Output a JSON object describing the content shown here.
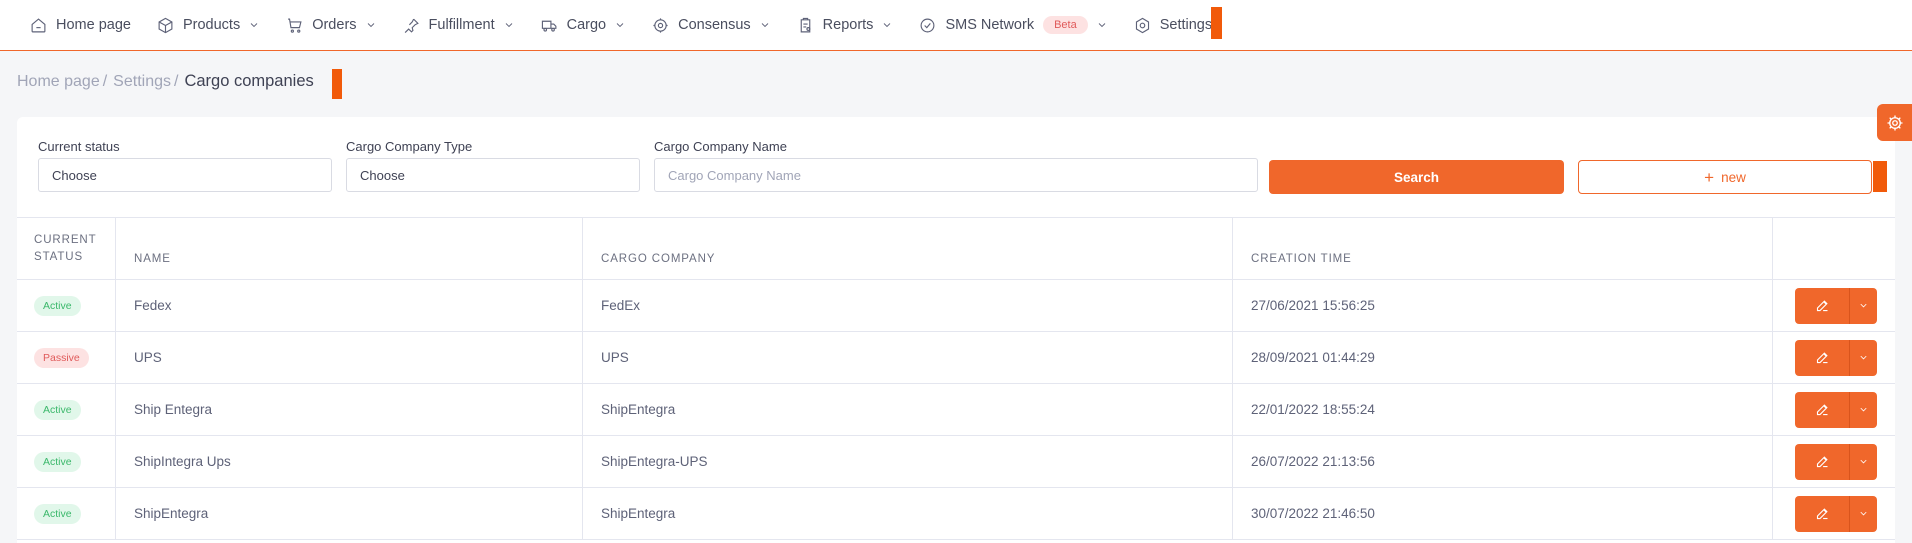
{
  "nav": {
    "items": [
      {
        "label": "Home page",
        "icon": "home-icon",
        "dropdown": false
      },
      {
        "label": "Products",
        "icon": "cube-icon",
        "dropdown": true
      },
      {
        "label": "Orders",
        "icon": "cart-icon",
        "dropdown": true
      },
      {
        "label": "Fulfillment",
        "icon": "pin-icon",
        "dropdown": true
      },
      {
        "label": "Cargo",
        "icon": "truck-icon",
        "dropdown": true
      },
      {
        "label": "Consensus",
        "icon": "target-icon",
        "dropdown": true
      },
      {
        "label": "Reports",
        "icon": "report-icon",
        "dropdown": true
      },
      {
        "label": "SMS Network",
        "icon": "check-circle-icon",
        "dropdown": true,
        "badge": "Beta"
      },
      {
        "label": "Settings",
        "icon": "gear-hex-icon",
        "dropdown": false
      }
    ]
  },
  "breadcrumb": {
    "items": [
      "Home page",
      "Settings"
    ],
    "separator": "/",
    "current": "Cargo companies"
  },
  "filters": {
    "status": {
      "label": "Current status",
      "value": "Choose"
    },
    "type": {
      "label": "Cargo Company Type",
      "value": "Choose"
    },
    "name": {
      "label": "Cargo Company Name",
      "placeholder": "Cargo Company Name"
    },
    "search_label": "Search",
    "new_label": "new"
  },
  "table": {
    "headers": {
      "status_line1": "CURRENT",
      "status_line2": "STATUS",
      "name": "NAME",
      "cargo_company": "CARGO COMPANY",
      "creation_time": "CREATION TIME"
    },
    "rows": [
      {
        "status": "Active",
        "name": "Fedex",
        "company": "FedEx",
        "created": "27/06/2021 15:56:25"
      },
      {
        "status": "Passive",
        "name": "UPS",
        "company": "UPS",
        "created": "28/09/2021 01:44:29"
      },
      {
        "status": "Active",
        "name": "Ship Entegra",
        "company": "ShipEntegra",
        "created": "22/01/2022 18:55:24"
      },
      {
        "status": "Active",
        "name": "ShipIntegra Ups",
        "company": "ShipEntegra-UPS",
        "created": "26/07/2022 21:13:56"
      },
      {
        "status": "Active",
        "name": "ShipEntegra",
        "company": "ShipEntegra",
        "created": "30/07/2022 21:46:50"
      }
    ]
  },
  "colors": {
    "accent": "#f0672b",
    "active_bg": "#e1f7ea",
    "active_text": "#3bb86b",
    "passive_bg": "#fde2e2",
    "passive_text": "#e05a5a"
  }
}
